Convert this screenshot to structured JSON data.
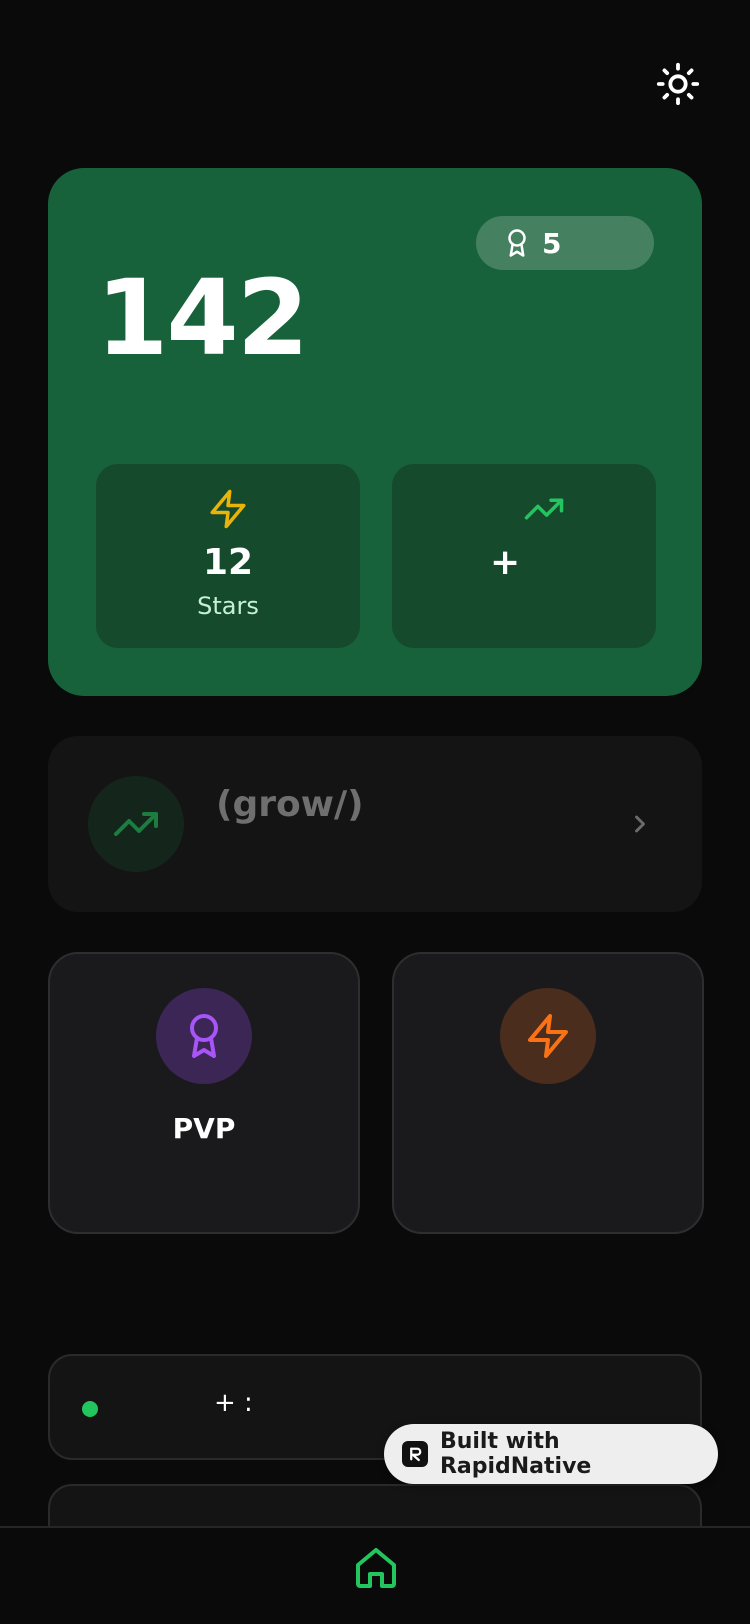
{
  "header": {
    "theme_toggle_icon": "sun-icon"
  },
  "score_card": {
    "score": "142",
    "badge": {
      "icon": "award-icon",
      "count": "5"
    },
    "stats": {
      "left": {
        "icon": "zap-icon",
        "value": "12",
        "label": "Stars"
      },
      "right": {
        "icon": "trending-up-icon",
        "value": "+"
      }
    }
  },
  "grow_card": {
    "icon": "trending-up-icon",
    "title": "(grow/)",
    "chevron_icon": "chevron-right-icon"
  },
  "modes": [
    {
      "icon": "award-icon",
      "label": "PVP"
    },
    {
      "icon": "zap-icon",
      "label": ""
    }
  ],
  "live_card": {
    "text": "+ :"
  },
  "built_badge": {
    "label": "Built with RapidNative"
  },
  "bottom_nav": {
    "home_icon": "home-icon"
  },
  "colors": {
    "background": "#0a0a0a",
    "score_card": "#17623a",
    "stat_box": "#154a2c",
    "accent_green": "#22c55e",
    "accent_yellow": "#eab308",
    "accent_purple": "#a855f7",
    "accent_orange": "#f97316"
  }
}
